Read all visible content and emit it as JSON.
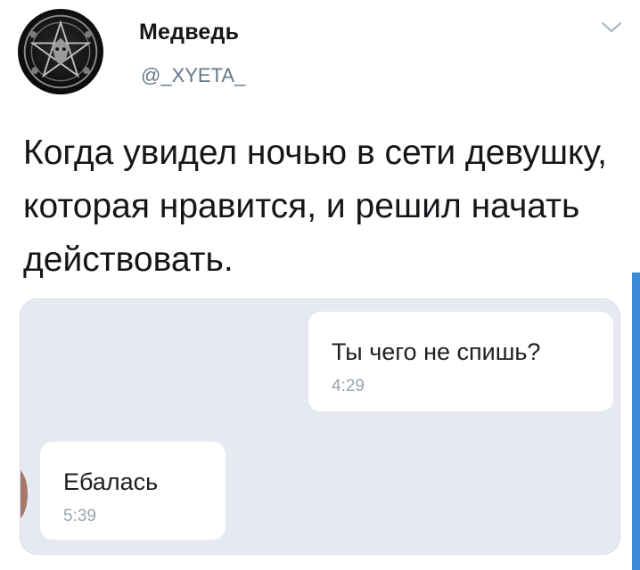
{
  "tweet": {
    "display_name": "Медведь",
    "handle": "@_XYETA_",
    "text": "Когда увидел ночью в сети девушку, которая нравится, и решил начать действовать."
  },
  "chat": {
    "messages": [
      {
        "text": "Ты чего не спишь?",
        "time": "4:29"
      },
      {
        "text": "Ебалась",
        "time": "5:39"
      }
    ]
  },
  "icons": {
    "avatar": "pentagram-avatar-icon",
    "menu": "chevron-down-icon"
  },
  "colors": {
    "chat_background": "#e6e9f1",
    "handle": "#657786",
    "accent_stripe": "#3e8ad8"
  }
}
